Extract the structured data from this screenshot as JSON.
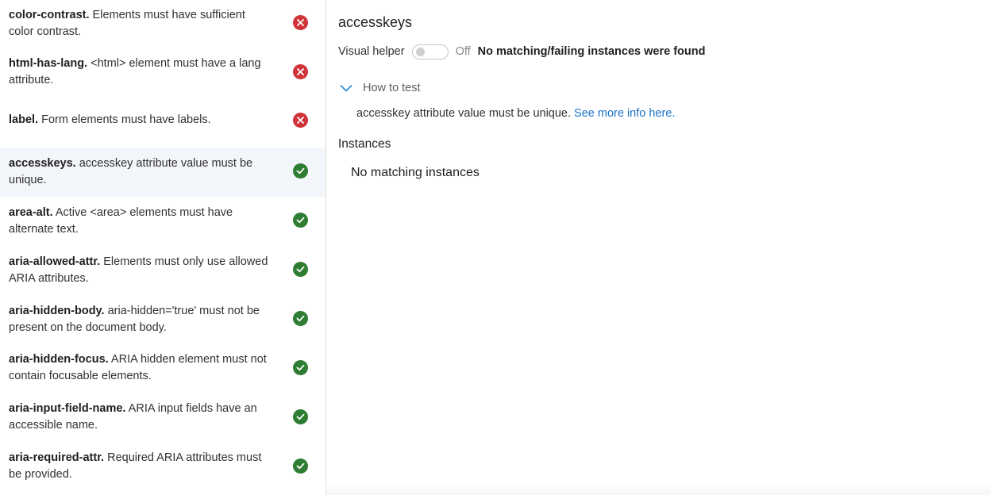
{
  "rules": [
    {
      "id": "color-contrast.",
      "description": "Elements must have sufficient color contrast.",
      "status": "fail"
    },
    {
      "id": "html-has-lang.",
      "description": "<html> element must have a lang attribute.",
      "status": "fail"
    },
    {
      "id": "label.",
      "description": "Form elements must have labels.",
      "status": "fail"
    },
    {
      "id": "accesskeys.",
      "description": "accesskey attribute value must be unique.",
      "status": "pass",
      "selected": true
    },
    {
      "id": "area-alt.",
      "description": "Active <area> elements must have alternate text.",
      "status": "pass"
    },
    {
      "id": "aria-allowed-attr.",
      "description": "Elements must only use allowed ARIA attributes.",
      "status": "pass"
    },
    {
      "id": "aria-hidden-body.",
      "description": "aria-hidden='true' must not be present on the document body.",
      "status": "pass"
    },
    {
      "id": "aria-hidden-focus.",
      "description": "ARIA hidden element must not contain focusable elements.",
      "status": "pass"
    },
    {
      "id": "aria-input-field-name.",
      "description": "ARIA input fields have an accessible name.",
      "status": "pass"
    },
    {
      "id": "aria-required-attr.",
      "description": "Required ARIA attributes must be provided.",
      "status": "pass"
    }
  ],
  "detail": {
    "title": "accesskeys",
    "visual_helper_label": "Visual helper",
    "toggle_state": "Off",
    "helper_message": "No matching/failing instances were found",
    "how_to_test_label": "How to test",
    "how_to_test_text": "accesskey attribute value must be unique.",
    "how_to_test_link": "See more info here.",
    "instances_heading": "Instances",
    "no_instances_text": "No matching instances"
  },
  "colors": {
    "fail": "#d13438",
    "pass": "#2e7d32",
    "link": "#1a73c8",
    "selected_bg": "#f2f5f9"
  }
}
